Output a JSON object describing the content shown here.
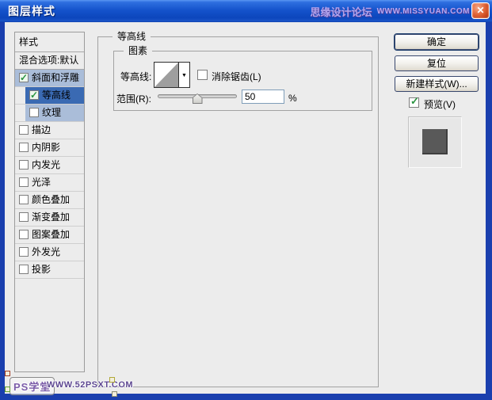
{
  "window": {
    "title": "图层样式",
    "titlebar_watermark": "思缘设计论坛",
    "titlebar_url": "WWW.MISSYUAN.COM",
    "close_glyph": "✕"
  },
  "sidebar": {
    "header": "样式",
    "blending_options": "混合选项:默认",
    "items": [
      {
        "label": "斜面和浮雕",
        "checked": true,
        "indent": false,
        "highlight": "light"
      },
      {
        "label": "等高线",
        "checked": true,
        "indent": true,
        "highlight": "selected"
      },
      {
        "label": "纹理",
        "checked": false,
        "indent": true,
        "highlight": "light"
      },
      {
        "label": "描边",
        "checked": false,
        "indent": false,
        "highlight": "none"
      },
      {
        "label": "内阴影",
        "checked": false,
        "indent": false,
        "highlight": "none"
      },
      {
        "label": "内发光",
        "checked": false,
        "indent": false,
        "highlight": "none"
      },
      {
        "label": "光泽",
        "checked": false,
        "indent": false,
        "highlight": "none"
      },
      {
        "label": "颜色叠加",
        "checked": false,
        "indent": false,
        "highlight": "none"
      },
      {
        "label": "渐变叠加",
        "checked": false,
        "indent": false,
        "highlight": "none"
      },
      {
        "label": "图案叠加",
        "checked": false,
        "indent": false,
        "highlight": "none"
      },
      {
        "label": "外发光",
        "checked": false,
        "indent": false,
        "highlight": "none"
      },
      {
        "label": "投影",
        "checked": false,
        "indent": false,
        "highlight": "none"
      }
    ]
  },
  "main": {
    "section_title": "等高线",
    "group_title": "图素",
    "contour_label": "等高线:",
    "contour_thumb": "linear-contour-thumbnail",
    "dropdown_glyph": "▼",
    "antialias_label": "消除锯齿(L)",
    "antialias_checked": false,
    "range_label": "范围(R):",
    "range_value": "50",
    "range_unit": "%",
    "range_percent": 50
  },
  "actions": {
    "ok": "确定",
    "reset": "复位",
    "new_style": "新建样式(W)...",
    "preview_label": "预览(V)",
    "preview_checked": true
  },
  "preview_swatch": {
    "well_color": "#e7e7e7",
    "swatch_color": "#595959"
  },
  "watermark": {
    "brand": "PS学堂",
    "url": "WWW.52PSXT.COM"
  },
  "colors": {
    "titlebar_blue": "#1553cc",
    "dialog_bg": "#ececec",
    "row_selected": "#3a6ab3",
    "row_highlight": "#aabdd9",
    "check_green": "#2a9440",
    "close_red": "#c33f17",
    "watermark_purple": "#7b5ca8",
    "titlebar_text_purple": "#b3a4ec"
  }
}
